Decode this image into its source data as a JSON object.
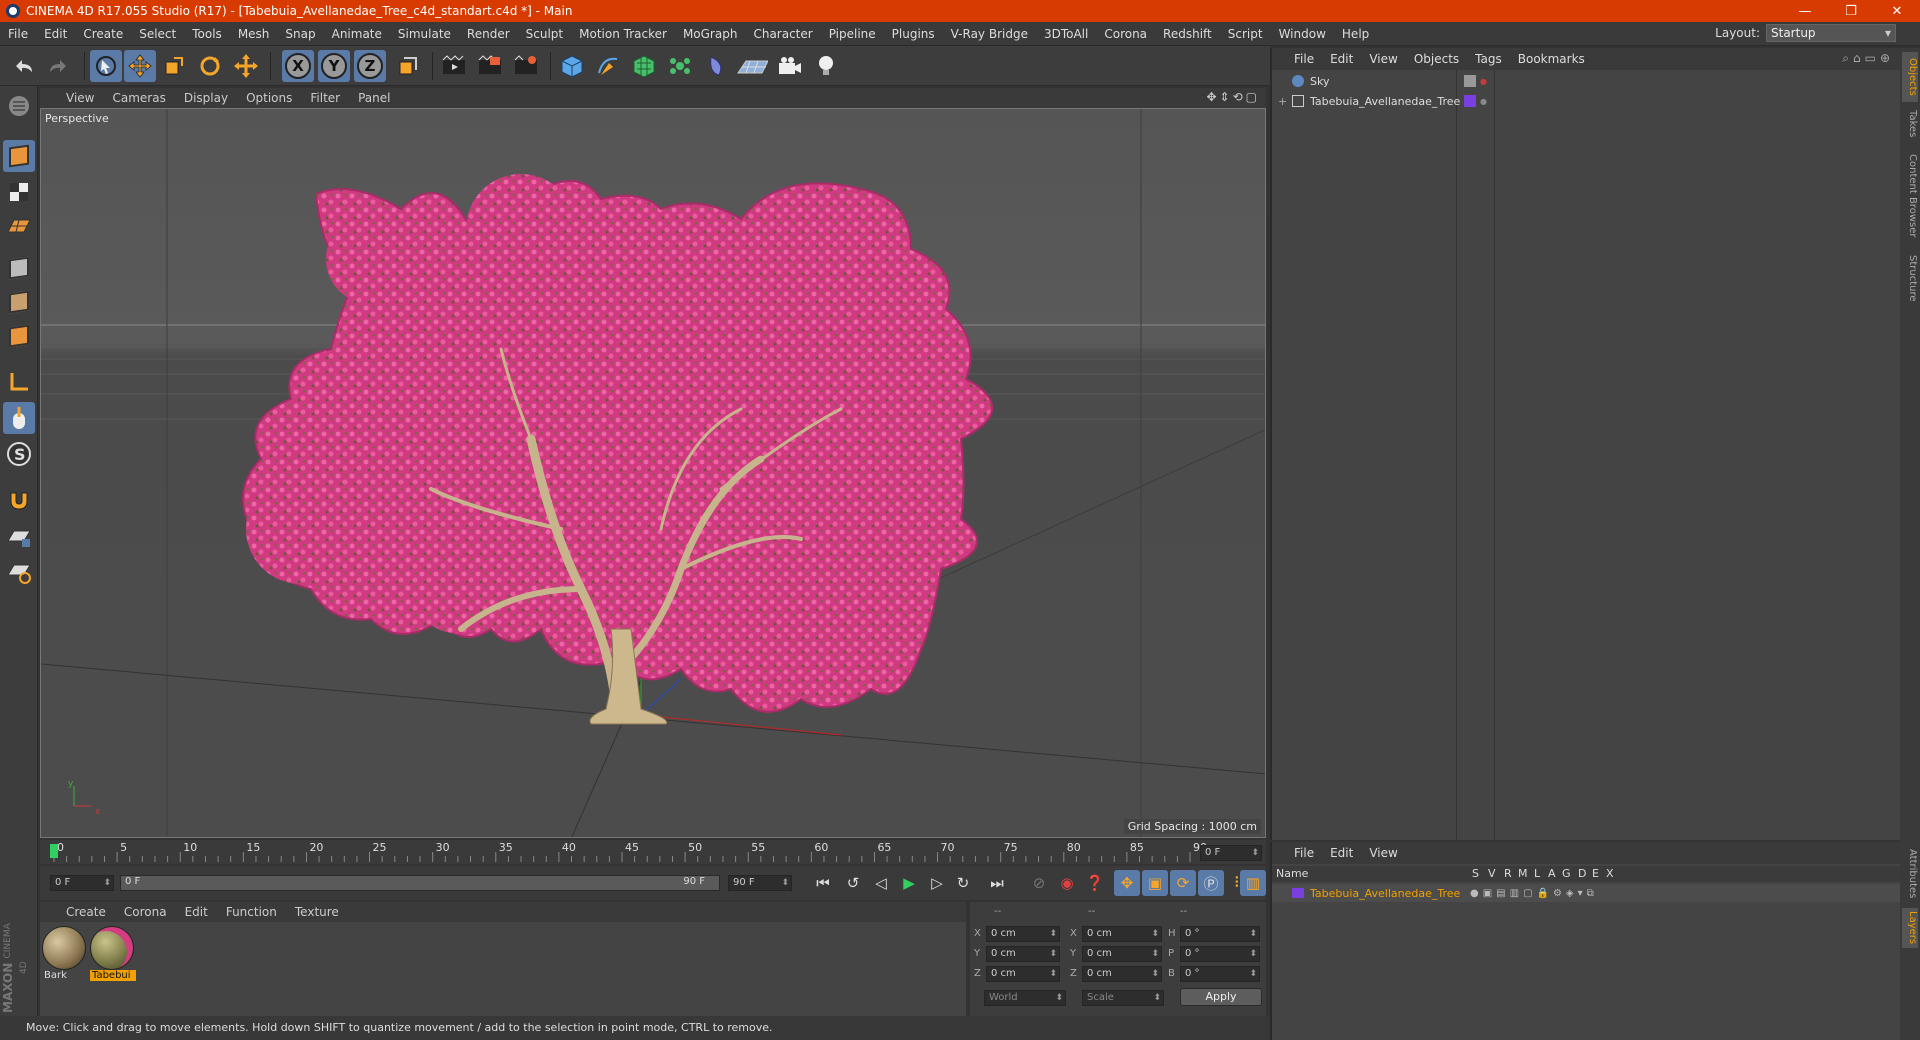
{
  "window": {
    "title": "CINEMA 4D R17.055 Studio (R17) - [Tabebuia_Avellanedae_Tree_c4d_standart.c4d *] - Main",
    "minimize": "—",
    "maximize": "❐",
    "close": "✕"
  },
  "menubar": {
    "items": [
      "File",
      "Edit",
      "Create",
      "Select",
      "Tools",
      "Mesh",
      "Snap",
      "Animate",
      "Simulate",
      "Render",
      "Sculpt",
      "Motion Tracker",
      "MoGraph",
      "Character",
      "Pipeline",
      "Plugins",
      "V-Ray Bridge",
      "3DToAll",
      "Corona",
      "Redshift",
      "Script",
      "Window",
      "Help"
    ],
    "layout_label": "Layout:",
    "layout_value": "Startup"
  },
  "toolbar": {
    "axis_x": "X",
    "axis_y": "Y",
    "axis_z": "Z"
  },
  "viewport": {
    "menu": [
      "View",
      "Cameras",
      "Display",
      "Options",
      "Filter",
      "Panel"
    ],
    "camera_label": "Perspective",
    "grid_spacing": "Grid Spacing : 1000 cm",
    "axis_x": "x",
    "axis_y": "y"
  },
  "timeline": {
    "ticks": [
      "0",
      "5",
      "10",
      "15",
      "20",
      "25",
      "30",
      "35",
      "40",
      "45",
      "50",
      "55",
      "60",
      "65",
      "70",
      "75",
      "80",
      "85",
      "90"
    ],
    "current_frame_field": "0 F",
    "start_field": "0 F",
    "range_start": "0 F",
    "range_end": "90 F",
    "end_field": "90 F"
  },
  "material_manager": {
    "menu": [
      "Create",
      "Corona",
      "Edit",
      "Function",
      "Texture"
    ],
    "materials": [
      {
        "name": "Bark",
        "selected": false
      },
      {
        "name": "Tabebui",
        "selected": true
      }
    ]
  },
  "coordinates": {
    "headers": [
      "--",
      "--",
      "--"
    ],
    "rows": [
      {
        "a": "X",
        "a_val": "0 cm",
        "b": "X",
        "b_val": "0 cm",
        "c": "H",
        "c_val": "0 °"
      },
      {
        "a": "Y",
        "a_val": "0 cm",
        "b": "Y",
        "b_val": "0 cm",
        "c": "P",
        "c_val": "0 °"
      },
      {
        "a": "Z",
        "a_val": "0 cm",
        "b": "Z",
        "b_val": "0 cm",
        "c": "B",
        "c_val": "0 °"
      }
    ],
    "space": "World",
    "mode": "Scale",
    "apply": "Apply"
  },
  "status": {
    "text": "Move: Click and drag to move elements. Hold down SHIFT to quantize movement / add to the selection in point mode, CTRL to remove."
  },
  "branding": {
    "maxon": "MAXON",
    "product": "CINEMA 4D"
  },
  "object_manager": {
    "menu": [
      "File",
      "Edit",
      "View",
      "Objects",
      "Tags",
      "Bookmarks"
    ],
    "objects": [
      {
        "name": "Sky",
        "expander": ""
      },
      {
        "name": "Tabebuia_Avellanedae_Tree",
        "expander": "+"
      }
    ]
  },
  "layer_manager": {
    "menu": [
      "File",
      "Edit",
      "View"
    ],
    "header": {
      "name": "Name",
      "cols": [
        "S",
        "V",
        "R",
        "M",
        "L",
        "A",
        "G",
        "D",
        "E",
        "X"
      ]
    },
    "layers": [
      {
        "name": "Tabebuia_Avellanedae_Tree"
      }
    ]
  },
  "right_tabs": [
    "Objects",
    "Takes",
    "Content Browser",
    "Structure",
    "Attributes",
    "Layers"
  ],
  "colors": {
    "titlebar": "#d83b01",
    "accent_active": "#5a7aa8",
    "selection_orange": "#f0a000",
    "layer_purple": "#7a3fe0",
    "blossom": "#d6357e"
  }
}
